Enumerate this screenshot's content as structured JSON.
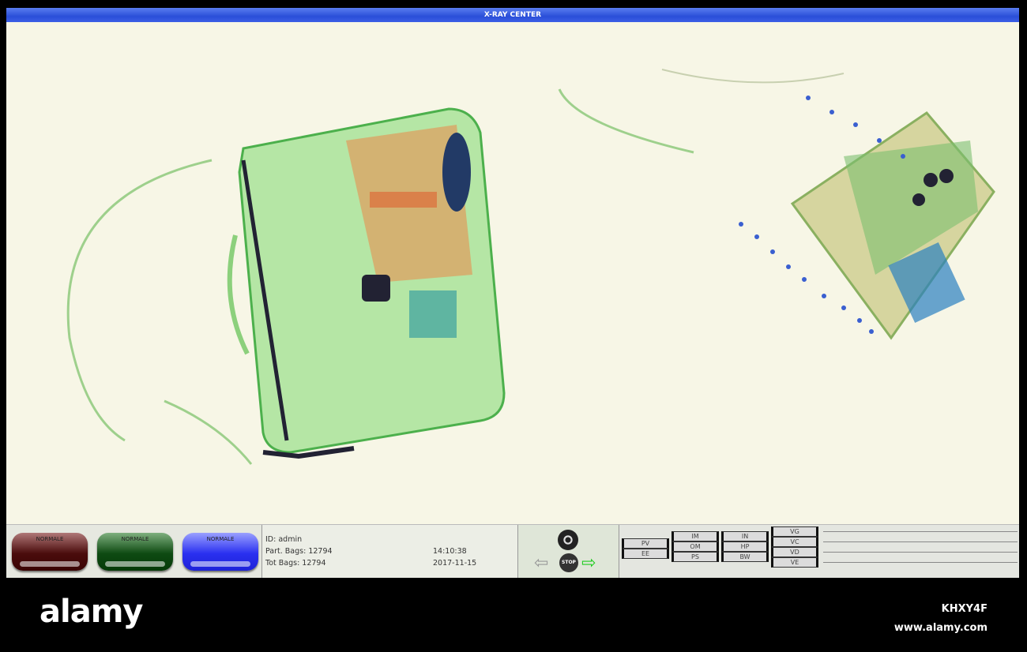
{
  "window": {
    "title": "X-RAY CENTER"
  },
  "modes": [
    {
      "label": "NORMALE",
      "color": "#5a1414"
    },
    {
      "label": "NORMALE",
      "color": "#14501a"
    },
    {
      "label": "NORMALE",
      "color": "#2a30f0"
    }
  ],
  "info": {
    "id": "ID: admin",
    "part_bags": "Part. Bags: 12794",
    "tot_bags": "Tot Bags: 12794",
    "time": "14:10:38",
    "date": "2017-11-15"
  },
  "controls": {
    "stop": "STOP",
    "radiation_icon": "radiation-icon",
    "left": "arrow-left-icon",
    "right": "arrow-right-icon"
  },
  "switches": {
    "col1": [
      "PV",
      "EE"
    ],
    "col2": [
      "IM",
      "OM",
      "PS"
    ],
    "col3": [
      "IN",
      "HP",
      "BW"
    ],
    "col4": [
      "VG",
      "VC",
      "VD",
      "VE"
    ]
  },
  "watermark": {
    "logo": "alamy",
    "id": "KHXY4F",
    "url": "www.alamy.com"
  }
}
